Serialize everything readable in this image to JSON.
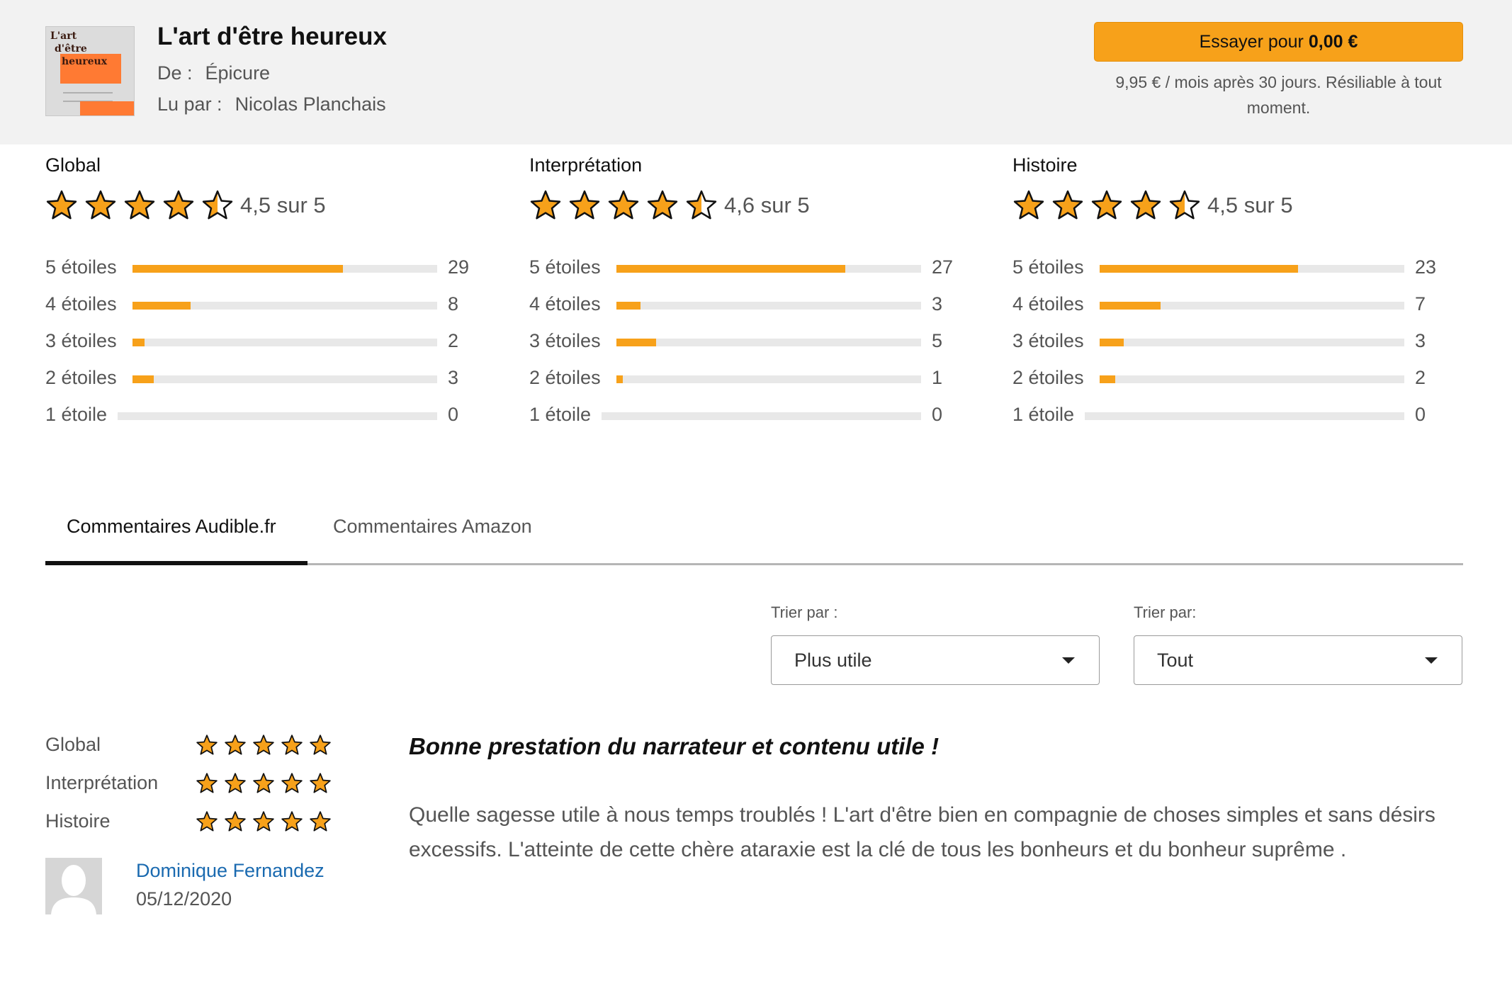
{
  "header": {
    "title": "L'art d'être heureux",
    "author_label": "De :",
    "author": "Épicure",
    "narrator_label": "Lu par :",
    "narrator": "Nicolas Planchais",
    "cover_text": [
      "L'art",
      "d'être",
      "heureux"
    ],
    "try_label": "Essayer pour",
    "try_price": "0,00 €",
    "try_note": "9,95 € / mois après 30 jours. Résiliable à tout moment."
  },
  "ratings": [
    {
      "title": "Global",
      "stars": 4.5,
      "average": "4,5 sur 5",
      "rows": [
        {
          "label": "5 étoiles",
          "count": "29",
          "share": 0.69
        },
        {
          "label": "4 étoiles",
          "count": "8",
          "share": 0.19
        },
        {
          "label": "3 étoiles",
          "count": "2",
          "share": 0.04
        },
        {
          "label": "2 étoiles",
          "count": "3",
          "share": 0.07
        },
        {
          "label": "1 étoile",
          "count": "0",
          "share": 0
        }
      ]
    },
    {
      "title": "Interprétation",
      "stars": 4.5,
      "average": "4,6 sur 5",
      "rows": [
        {
          "label": "5 étoiles",
          "count": "27",
          "share": 0.75
        },
        {
          "label": "4 étoiles",
          "count": "3",
          "share": 0.08
        },
        {
          "label": "3 étoiles",
          "count": "5",
          "share": 0.13
        },
        {
          "label": "2 étoiles",
          "count": "1",
          "share": 0.02
        },
        {
          "label": "1 étoile",
          "count": "0",
          "share": 0
        }
      ]
    },
    {
      "title": "Histoire",
      "stars": 4.5,
      "average": "4,5 sur 5",
      "rows": [
        {
          "label": "5 étoiles",
          "count": "23",
          "share": 0.65
        },
        {
          "label": "4 étoiles",
          "count": "7",
          "share": 0.2
        },
        {
          "label": "3 étoiles",
          "count": "3",
          "share": 0.08
        },
        {
          "label": "2 étoiles",
          "count": "2",
          "share": 0.05
        },
        {
          "label": "1 étoile",
          "count": "0",
          "share": 0
        }
      ]
    }
  ],
  "tabs": {
    "audible": "Commentaires Audible.fr",
    "amazon": "Commentaires Amazon",
    "active": "audible"
  },
  "sort": {
    "sort_by_label": "Trier par :",
    "sort_by_value": "Plus utile",
    "filter_label": "Trier par:",
    "filter_value": "Tout"
  },
  "review": {
    "ratings": [
      {
        "label": "Global",
        "stars": 5
      },
      {
        "label": "Interprétation",
        "stars": 5
      },
      {
        "label": "Histoire",
        "stars": 5
      }
    ],
    "reviewer": "Dominique Fernandez",
    "date": "05/12/2020",
    "title": "Bonne prestation du narrateur et contenu utile !",
    "body": "Quelle sagesse utile à nous temps troublés ! L'art d'être bien en compagnie de choses simples et sans désirs excessifs. L'atteinte de cette chère ataraxie est la clé de tous les bonheurs et du bonheur suprême ."
  },
  "colors": {
    "accent": "#f7a11a",
    "link": "#1a6ab0",
    "header_bg": "#f2f2f2"
  },
  "icons": {
    "star": "star-icon",
    "half_star": "half-star-icon",
    "caret": "chevron-down-icon",
    "avatar": "user-placeholder-icon"
  }
}
